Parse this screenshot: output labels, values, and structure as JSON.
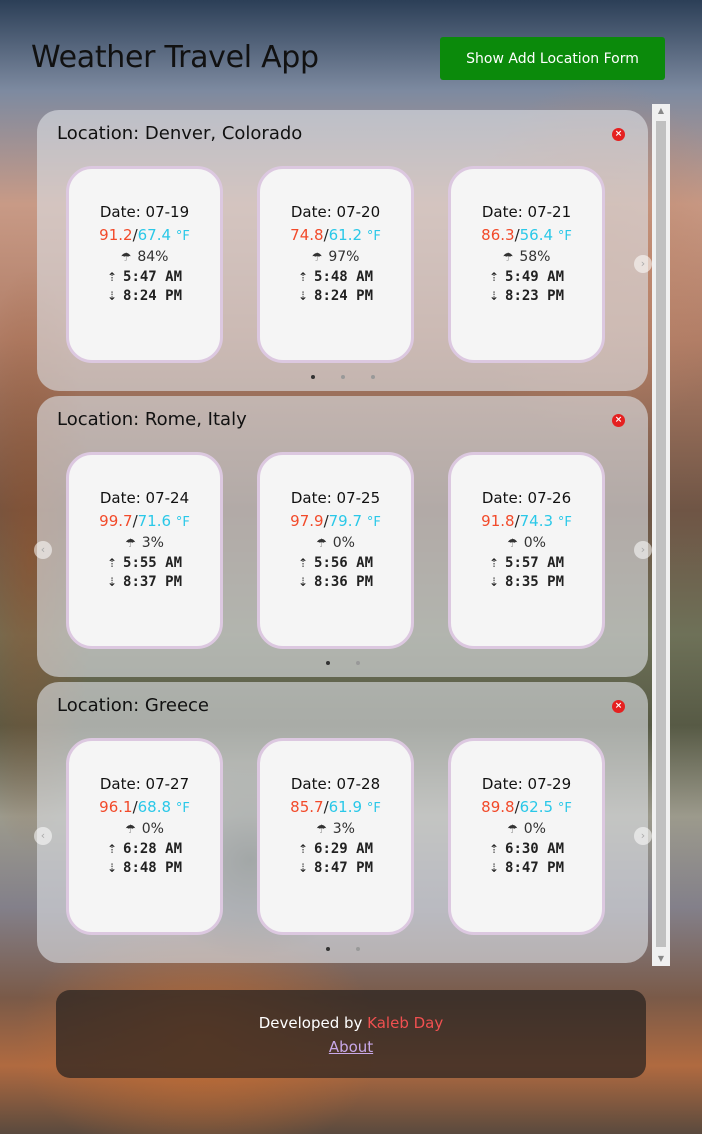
{
  "app": {
    "title": "Weather Travel App",
    "add_button_label": "Show Add Location Form"
  },
  "locations": [
    {
      "title": "Location: Denver, Colorado",
      "days": [
        {
          "date": "Date: 07-19",
          "high": "91.2",
          "low": "67.4",
          "unit": "°F",
          "rain": "84%",
          "sunrise": "5:47 AM",
          "sunset": "8:24 PM"
        },
        {
          "date": "Date: 07-20",
          "high": "74.8",
          "low": "61.2",
          "unit": "°F",
          "rain": "97%",
          "sunrise": "5:48 AM",
          "sunset": "8:24 PM"
        },
        {
          "date": "Date: 07-21",
          "high": "86.3",
          "low": "56.4",
          "unit": "°F",
          "rain": "58%",
          "sunrise": "5:49 AM",
          "sunset": "8:23 PM"
        }
      ]
    },
    {
      "title": "Location: Rome, Italy",
      "days": [
        {
          "date": "Date: 07-24",
          "high": "99.7",
          "low": "71.6",
          "unit": "°F",
          "rain": "3%",
          "sunrise": "5:55 AM",
          "sunset": "8:37 PM"
        },
        {
          "date": "Date: 07-25",
          "high": "97.9",
          "low": "79.7",
          "unit": "°F",
          "rain": "0%",
          "sunrise": "5:56 AM",
          "sunset": "8:36 PM"
        },
        {
          "date": "Date: 07-26",
          "high": "91.8",
          "low": "74.3",
          "unit": "°F",
          "rain": "0%",
          "sunrise": "5:57 AM",
          "sunset": "8:35 PM"
        }
      ]
    },
    {
      "title": "Location: Greece",
      "days": [
        {
          "date": "Date: 07-27",
          "high": "96.1",
          "low": "68.8",
          "unit": "°F",
          "rain": "0%",
          "sunrise": "6:28 AM",
          "sunset": "8:48 PM"
        },
        {
          "date": "Date: 07-28",
          "high": "85.7",
          "low": "61.9",
          "unit": "°F",
          "rain": "3%",
          "sunrise": "6:29 AM",
          "sunset": "8:47 PM"
        },
        {
          "date": "Date: 07-29",
          "high": "89.8",
          "low": "62.5",
          "unit": "°F",
          "rain": "0%",
          "sunrise": "6:30 AM",
          "sunset": "8:47 PM"
        }
      ]
    }
  ],
  "icons": {
    "close": "close-circle-icon",
    "rain": "rain-cloud-icon",
    "sunrise": "sunrise-icon",
    "sunset": "sunset-icon",
    "next": "chevron-right-icon",
    "prev": "chevron-left-icon"
  },
  "colors": {
    "high_temp": "#f24a2a",
    "low_temp": "#2ac8e8",
    "add_button": "#0b8a0b",
    "developer_name": "#f05050",
    "close_icon": "#e52020"
  },
  "footer": {
    "developed_by": "Developed by ",
    "developer_name": "Kaleb Day",
    "about_link": "About"
  }
}
